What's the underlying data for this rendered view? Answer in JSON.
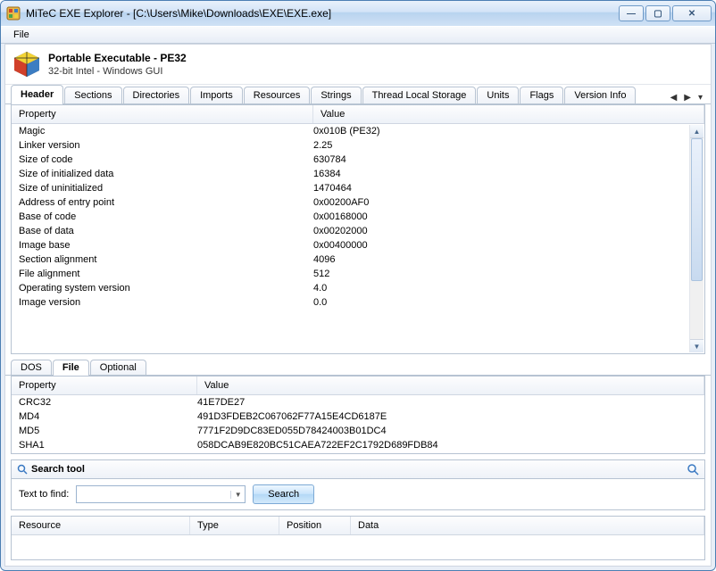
{
  "window": {
    "title": "MiTeC EXE Explorer - [C:\\Users\\Mike\\Downloads\\EXE\\EXE.exe]"
  },
  "menu": {
    "file": "File"
  },
  "pe": {
    "title": "Portable Executable - PE32",
    "subtitle": "32-bit Intel - Windows GUI"
  },
  "tabs": {
    "items": [
      "Header",
      "Sections",
      "Directories",
      "Imports",
      "Resources",
      "Strings",
      "Thread Local Storage",
      "Units",
      "Flags",
      "Version Info"
    ],
    "active": 0
  },
  "header_table": {
    "cols": [
      "Property",
      "Value"
    ],
    "rows": [
      {
        "prop": "Magic",
        "val": "0x010B (PE32)"
      },
      {
        "prop": "Linker version",
        "val": "2.25"
      },
      {
        "prop": "Size of code",
        "val": "630784"
      },
      {
        "prop": "Size of initialized data",
        "val": "16384"
      },
      {
        "prop": "Size of uninitialized",
        "val": "1470464"
      },
      {
        "prop": "Address of entry point",
        "val": "0x00200AF0"
      },
      {
        "prop": "Base of code",
        "val": "0x00168000"
      },
      {
        "prop": "Base of data",
        "val": "0x00202000"
      },
      {
        "prop": "Image base",
        "val": "0x00400000"
      },
      {
        "prop": "Section alignment",
        "val": "4096"
      },
      {
        "prop": "File alignment",
        "val": "512"
      },
      {
        "prop": "Operating system version",
        "val": "4.0"
      },
      {
        "prop": "Image version",
        "val": "0.0"
      }
    ]
  },
  "subtabs": {
    "items": [
      "DOS",
      "File",
      "Optional"
    ],
    "active": 1
  },
  "hash_table": {
    "cols": [
      "Property",
      "Value"
    ],
    "rows": [
      {
        "prop": "CRC32",
        "val": "41E7DE27"
      },
      {
        "prop": "MD4",
        "val": "491D3FDEB2C067062F77A15E4CD6187E"
      },
      {
        "prop": "MD5",
        "val": "7771F2D9DC83ED055D78424003B01DC4"
      },
      {
        "prop": "SHA1",
        "val": "058DCAB9E820BC51CAEA722EF2C1792D689FDB84"
      }
    ]
  },
  "search": {
    "heading": "Search tool",
    "label": "Text to find:",
    "button": "Search",
    "value": ""
  },
  "results": {
    "cols": [
      "Resource",
      "Type",
      "Position",
      "Data"
    ]
  }
}
